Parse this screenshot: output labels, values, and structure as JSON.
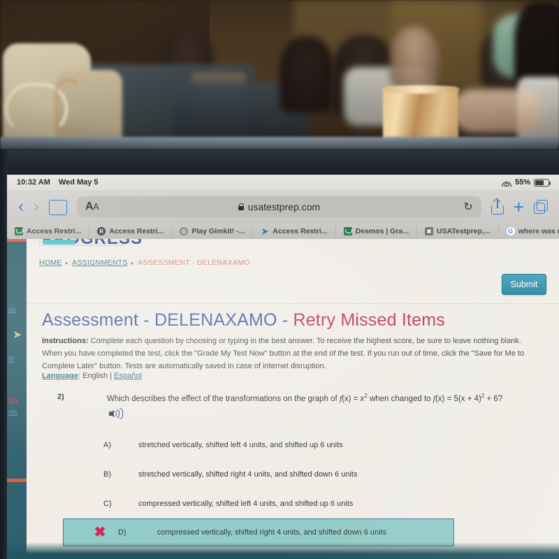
{
  "photo": {
    "description": "blurry photo of a classroom with students seated at desks, taken over the top of a tablet"
  },
  "status_bar": {
    "time": "10:32 AM",
    "date": "Wed May 5",
    "wifi_icon": "wifi-icon",
    "battery_percent": "55%",
    "battery_icon": "battery-icon"
  },
  "toolbar": {
    "back_icon": "chevron-left-icon",
    "forward_icon": "chevron-right-icon",
    "bookmarks_icon": "book-icon",
    "text_size_label": "AA",
    "lock_icon": "lock-icon",
    "url": "usatestprep.com",
    "reload_icon": "reload-icon",
    "share_icon": "share-icon",
    "new_tab_icon": "plus-icon",
    "tabs_icon": "tabs-icon"
  },
  "bookmarks": [
    {
      "label": "Access Restri...",
      "icon": "desmos-icon"
    },
    {
      "label": "Access Restri...",
      "icon": "r-circle-icon"
    },
    {
      "label": "Play Gimkit! -...",
      "icon": "c-circle-icon"
    },
    {
      "label": "Access Restri...",
      "icon": "cursor-icon"
    },
    {
      "label": "Desmos | Gra...",
      "icon": "desmos-icon"
    },
    {
      "label": "USATestprep,...",
      "icon": "x-square-icon"
    },
    {
      "label": "where was ma...",
      "icon": "google-icon"
    }
  ],
  "sidebar_rail": {
    "fragment_1": "as",
    "chevron_icon": "chevron-right-icon",
    "fragment_2": "ht",
    "fragment_3": "ing",
    "fragment_4": "10",
    "fragment_5": "ols"
  },
  "page": {
    "progress_label": "PROGRESS",
    "breadcrumb": {
      "home": "HOME",
      "assignments": "ASSIGNMENTS",
      "current": "ASSESSMENT - DELENAXAMO",
      "separator": "▸"
    },
    "submit_label": "Submit",
    "title_part_1": "Assessment - DELENAXAMO - ",
    "title_part_2": "Retry Missed Items",
    "instructions_label": "Instructions:",
    "instructions_body": " Complete each question by choosing or typing in the best answer. To receive the highest score, be sure to leave nothing blank. When you have completed the test, click the \"Grade My Test Now\" button at the end of the test. If you run out of time, click the \"Save for Me to Complete Later\" button. Tests are automatically saved in case of internet disruption.",
    "language_label": "Language",
    "language_sep": ": ",
    "language_english": "English",
    "language_pipe": " | ",
    "language_spanish": "Español"
  },
  "question": {
    "number": "2)",
    "prompt_pre": "Which describes the effect of the transformations on the graph of ",
    "fx1": "f",
    "fx1b": "(x) = x",
    "exp1": "2",
    "prompt_mid": " when changed to ",
    "fx2": "f",
    "fx2b": "(x) = 5(x + 4)",
    "exp2": "2",
    "prompt_end": " + 6?",
    "audio_icon": "speaker-icon",
    "options": [
      {
        "letter": "A)",
        "text": "stretched vertically, shifted left 4 units, and shifted up 6 units",
        "selected": false,
        "marked_incorrect": false
      },
      {
        "letter": "B)",
        "text": "stretched vertically, shifted right 4 units, and shifted down 6 units",
        "selected": false,
        "marked_incorrect": false
      },
      {
        "letter": "C)",
        "text": "compressed vertically, shifted left 4 units, and shifted up 6 units",
        "selected": false,
        "marked_incorrect": false
      },
      {
        "letter": "D)",
        "text": "compressed vertically, shifted right 4 units, and shifted down 6 units",
        "selected": true,
        "marked_incorrect": true
      }
    ],
    "incorrect_icon": "x-mark-icon",
    "incorrect_glyph": "✖"
  },
  "colors": {
    "title_blue": "#4a5fa5",
    "title_pink": "#c0395e",
    "submit_teal": "#2e8aa6",
    "selected_option_bg": "#93ccc8",
    "selected_option_border": "#4a6f9e",
    "x_mark": "#d0255f",
    "rail_teal": "#2e5f6d",
    "safari_blue": "#2b7cd3"
  }
}
